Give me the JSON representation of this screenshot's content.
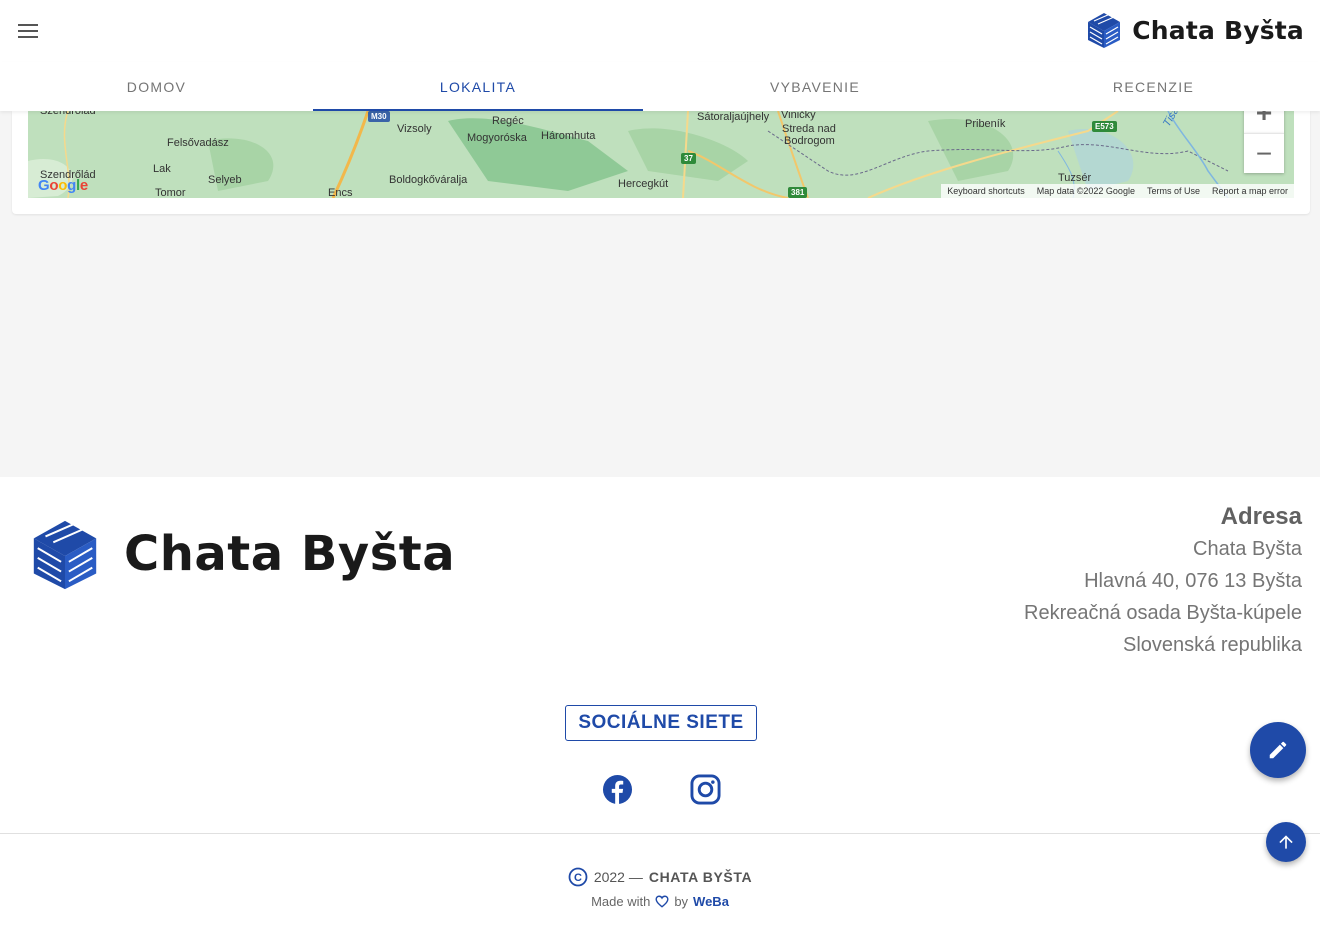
{
  "header": {
    "menu_icon": "hamburger-menu-icon",
    "brand": {
      "title": "Chata Byšta",
      "logo_icon": "house-logo-icon"
    },
    "tabs": [
      {
        "label": "Domov",
        "active": false
      },
      {
        "label": "Lokalita",
        "active": true
      },
      {
        "label": "Vybavenie",
        "active": false
      },
      {
        "label": "Recenzie",
        "active": false
      }
    ]
  },
  "map": {
    "labels": [
      "Szendrőlád",
      "Felsővadász",
      "Lak",
      "Selyeb",
      "Tomor",
      "Vizsoly",
      "Regéc",
      "Mogyoróska",
      "Háromhuta",
      "Boldogkőváralja",
      "Encs",
      "Sátoraljaújhely",
      "Viničky",
      "Streda nad",
      "Bodrogom",
      "Hercegkút",
      "Pribeník",
      "Tuzsér",
      "Tisa"
    ],
    "road_badges": [
      "M30",
      "37",
      "381",
      "E573"
    ],
    "zoom_in": "+",
    "zoom_out": "−",
    "footer_links": [
      "Keyboard shortcuts",
      "Map data ©2022 Google",
      "Terms of Use",
      "Report a map error"
    ],
    "google": [
      "G",
      "o",
      "o",
      "g",
      "l",
      "e"
    ]
  },
  "footer": {
    "brand_title": "Chata Byšta",
    "address": {
      "heading": "Adresa",
      "lines": [
        "Chata Byšta",
        "Hlavná 40, 076 13 Byšta",
        "Rekreačná osada Byšta-kúpele",
        "Slovenská republika"
      ]
    },
    "social_label": "Sociálne siete",
    "social_icons": [
      "facebook-icon",
      "instagram-icon"
    ],
    "copyright_year": "2022 —",
    "copyright_name": "CHATA BYŠTA",
    "made_with": "Made with",
    "by": "by",
    "author": "WeBa"
  },
  "colors": {
    "primary": "#1f4aa8",
    "map_green": "#b7dbb6",
    "gray_bg": "#f5f5f5"
  },
  "fabs": {
    "edit_icon": "pencil-icon",
    "scroll_top_icon": "arrow-up-icon"
  }
}
